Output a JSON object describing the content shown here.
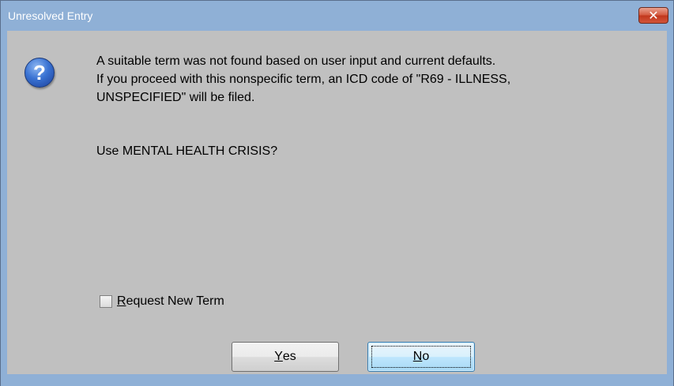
{
  "window": {
    "title": "Unresolved Entry",
    "close_symbol": "✕",
    "colors": {
      "titlebar": "#8fb0d6",
      "close": "#c1371d",
      "client": "#c0c0c0"
    }
  },
  "message": {
    "line1": "A suitable term was not found based on user input and current defaults.",
    "line2": "If you proceed with this nonspecific term, an ICD code of \"R69 - ILLNESS,",
    "line3": "UNSPECIFIED\" will be filed.",
    "question": "Use  MENTAL HEALTH CRISIS?"
  },
  "icon": {
    "name": "question-icon",
    "glyph": "?"
  },
  "checkbox": {
    "checked": false,
    "label_mnemonic": "R",
    "label_rest": "equest New Term"
  },
  "buttons": {
    "yes": {
      "mnemonic": "Y",
      "rest": "es"
    },
    "no": {
      "mnemonic": "N",
      "rest": "o"
    }
  }
}
